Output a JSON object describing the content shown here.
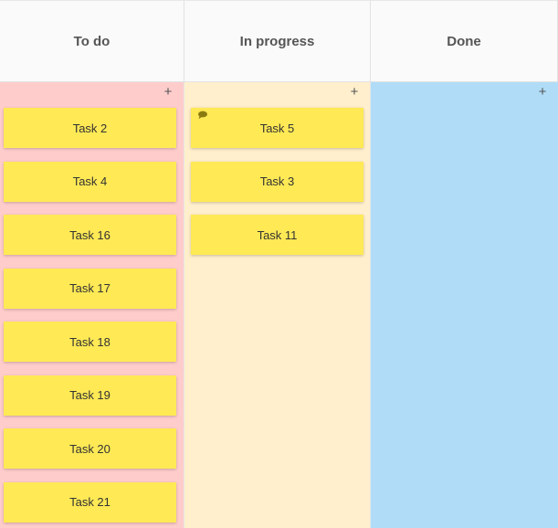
{
  "columns": [
    {
      "title": "To do",
      "add_label": "+",
      "cards": [
        {
          "label": "Task 2",
          "has_comment": false
        },
        {
          "label": "Task 4",
          "has_comment": false
        },
        {
          "label": "Task 16",
          "has_comment": false
        },
        {
          "label": "Task 17",
          "has_comment": false
        },
        {
          "label": "Task 18",
          "has_comment": false
        },
        {
          "label": "Task 19",
          "has_comment": false
        },
        {
          "label": "Task 20",
          "has_comment": false
        },
        {
          "label": "Task 21",
          "has_comment": false
        }
      ]
    },
    {
      "title": "In progress",
      "add_label": "+",
      "cards": [
        {
          "label": "Task 5",
          "has_comment": true
        },
        {
          "label": "Task 3",
          "has_comment": false
        },
        {
          "label": "Task 11",
          "has_comment": false
        }
      ]
    },
    {
      "title": "Done",
      "add_label": "+",
      "cards": []
    }
  ],
  "colors": {
    "todo_bg": "#ffcccc",
    "in_progress_bg": "#ffefcc",
    "done_bg": "#b0dcf7",
    "card_bg": "#ffe955",
    "comment_icon": "#8a7a10"
  },
  "icons": {
    "add": "plus-icon",
    "comment": "comment-icon"
  }
}
